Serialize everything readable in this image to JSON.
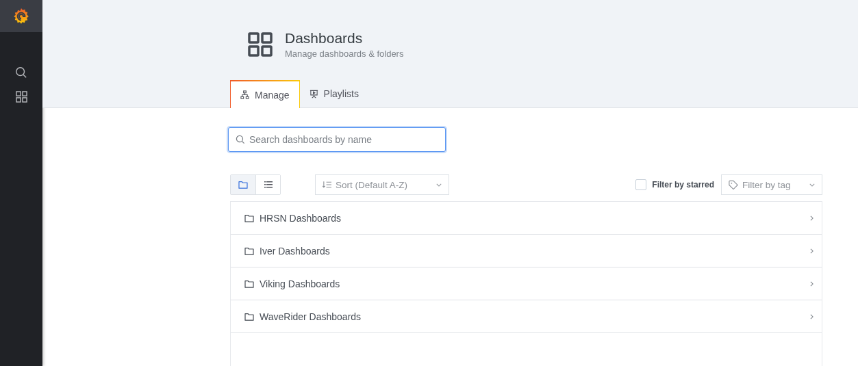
{
  "header": {
    "title": "Dashboards",
    "subtitle": "Manage dashboards & folders"
  },
  "tabs": [
    {
      "label": "Manage",
      "kind": "manage",
      "selected": true
    },
    {
      "label": "Playlists",
      "kind": "playlists",
      "selected": false
    }
  ],
  "search": {
    "placeholder": "Search dashboards by name"
  },
  "view_toggle": [
    {
      "kind": "folder",
      "selected": true
    },
    {
      "kind": "list",
      "selected": false
    }
  ],
  "sort": {
    "placeholder": "Sort (Default A-Z)"
  },
  "filter_starred": {
    "label": "Filter by starred",
    "checked": false
  },
  "filter_tag": {
    "placeholder": "Filter by tag"
  },
  "folders": [
    {
      "name": "HRSN Dashboards"
    },
    {
      "name": "Iver Dashboards"
    },
    {
      "name": "Viking Dashboards"
    },
    {
      "name": "WaveRider Dashboards"
    }
  ]
}
